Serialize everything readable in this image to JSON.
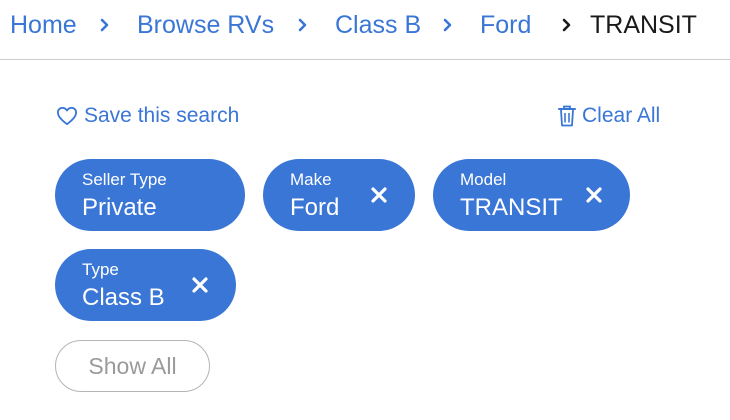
{
  "breadcrumb": {
    "items": [
      "Home",
      "Browse RVs",
      "Class B",
      "Ford",
      "TRANSIT"
    ]
  },
  "actions": {
    "save_search": "Save this search",
    "clear_all": "Clear All"
  },
  "filters": [
    {
      "label": "Seller Type",
      "value": "Private"
    },
    {
      "label": "Make",
      "value": "Ford"
    },
    {
      "label": "Model",
      "value": "TRANSIT"
    },
    {
      "label": "Type",
      "value": "Class B"
    }
  ],
  "show_all": "Show All",
  "icons": {
    "separator": "chevron-right-icon",
    "save": "heart-outline-icon",
    "clear": "trash-icon",
    "remove": "close-icon"
  },
  "colors": {
    "accent": "#3a76d6",
    "text": "#1a1a1a",
    "muted": "#9a9a9a",
    "divider": "#cccccc"
  }
}
